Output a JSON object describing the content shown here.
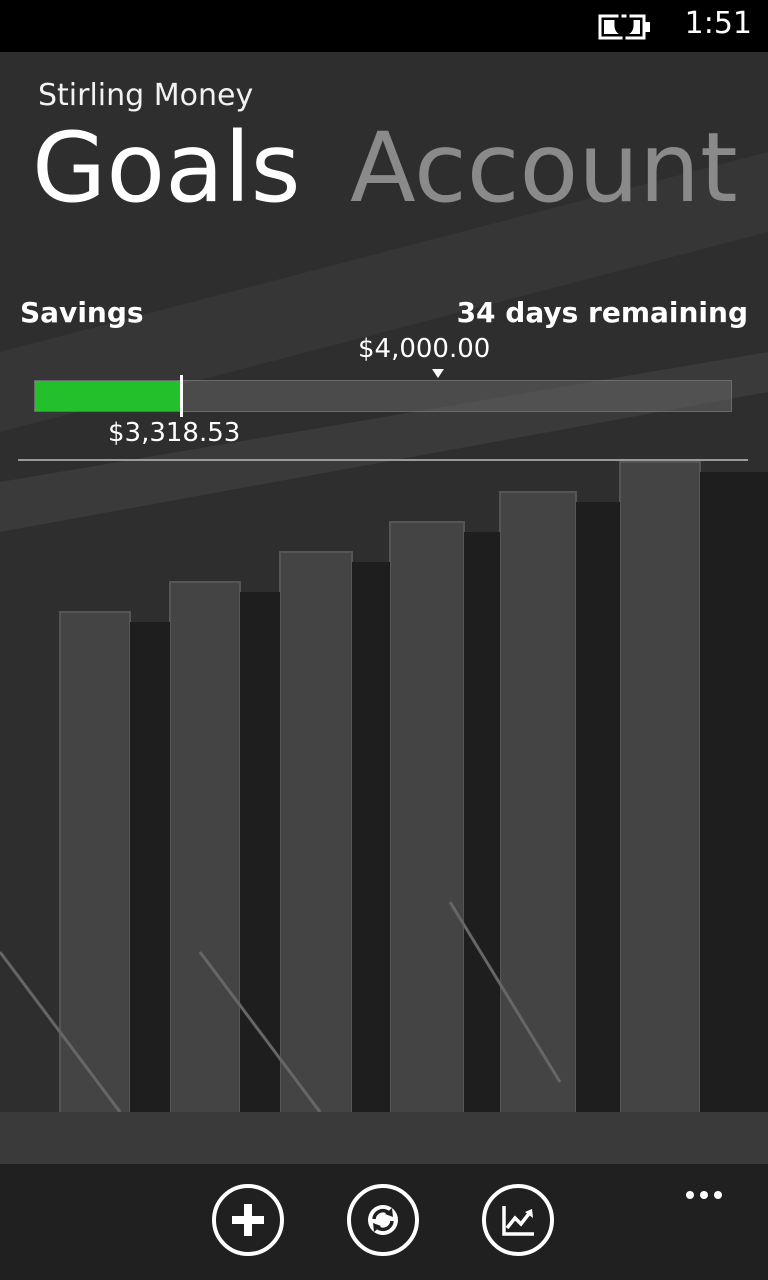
{
  "status_bar": {
    "time": "1:51"
  },
  "app": {
    "title": "Stirling Money"
  },
  "pivot": {
    "active": "Goals",
    "next": "Account"
  },
  "goal": {
    "name": "Savings",
    "remaining": "34 days remaining",
    "target_label": "$4,000.00",
    "current_label": "$3,318.53",
    "progress_fraction": 0.21,
    "target_marker_fraction": 0.58,
    "accent_color": "#22c12b"
  },
  "app_bar": {
    "buttons": [
      {
        "icon": "add-icon"
      },
      {
        "icon": "sync-icon"
      },
      {
        "icon": "chart-icon"
      }
    ],
    "more": "more-icon"
  }
}
